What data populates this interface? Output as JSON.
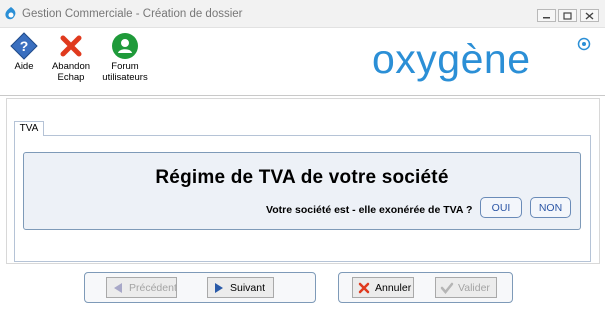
{
  "window": {
    "title": "Gestion Commerciale - Création de dossier"
  },
  "toolbar": {
    "aide_label": "Aide",
    "abandon_label": "Abandon\nEchap",
    "forum_label": "Forum\nutilisateurs"
  },
  "logo": {
    "text": "oxygène"
  },
  "tab": {
    "label": "TVA"
  },
  "panel": {
    "heading": "Régime de TVA de votre société",
    "question": "Votre société est - elle exonérée de TVA  ?",
    "oui_label": "OUI",
    "non_label": "NON"
  },
  "nav": {
    "precedent_label": "Précédent",
    "suivant_label": "Suivant",
    "annuler_label": "Annuler",
    "valider_label": "Valider"
  },
  "colors": {
    "logo_blue": "#2b8fd6",
    "accent_blue": "#2c56a6",
    "panel_bg": "#edf1f7"
  }
}
